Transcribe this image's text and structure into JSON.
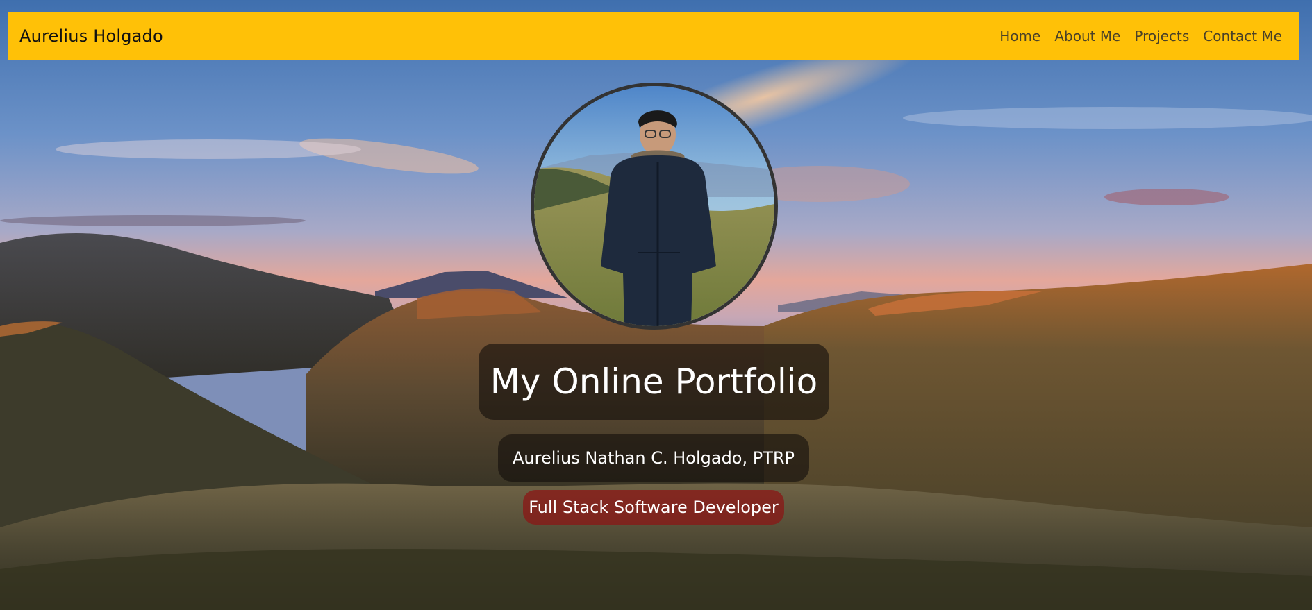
{
  "navbar": {
    "brand": "Aurelius Holgado",
    "links": [
      {
        "label": "Home"
      },
      {
        "label": "About Me"
      },
      {
        "label": "Projects"
      },
      {
        "label": "Contact Me"
      }
    ]
  },
  "hero": {
    "title": "My Online Portfolio",
    "name": "Aurelius Nathan C. Holgado, PTRP",
    "role": "Full Stack Software Developer"
  },
  "colors": {
    "navbar_bg": "#ffc107",
    "role_badge_bg": "#8c1414",
    "text_badge_bg": "#14100c"
  },
  "icons": {
    "avatar": "profile-photo"
  }
}
